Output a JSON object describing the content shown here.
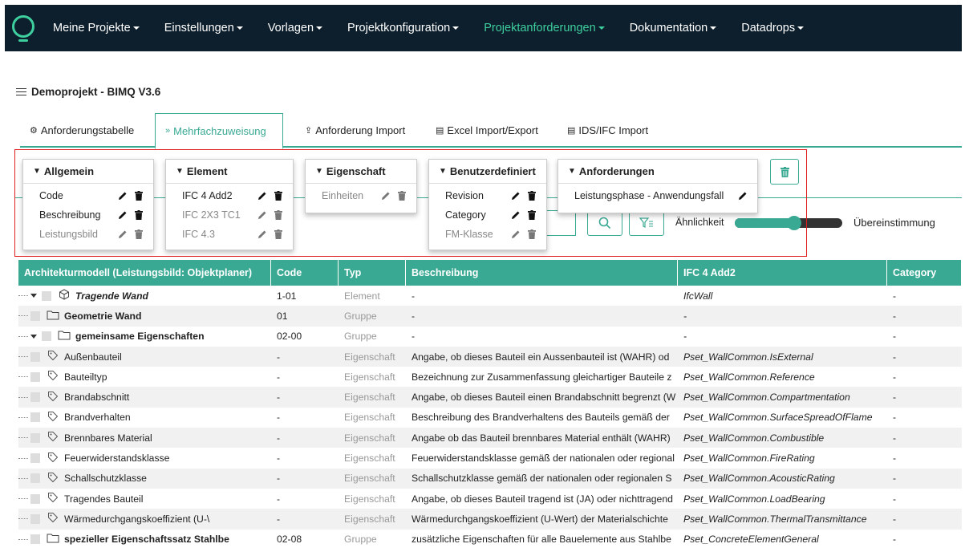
{
  "nav": {
    "items": [
      {
        "label": "Meine Projekte",
        "caret": true
      },
      {
        "label": "Einstellungen",
        "caret": true
      },
      {
        "label": "Vorlagen",
        "caret": true
      },
      {
        "label": "Projektkonfiguration",
        "caret": true
      },
      {
        "label": "Projektanforderungen",
        "caret": true,
        "active": true
      },
      {
        "label": "Dokumentation",
        "caret": true
      },
      {
        "label": "Datadrops",
        "caret": true
      }
    ],
    "accent": "#3ecf9e",
    "background": "#0d1f2d"
  },
  "project_title": "Demoprojekt - BIMQ V3.6",
  "tabs": [
    {
      "label": "Anforderungstabelle",
      "icon": "cogs-icon"
    },
    {
      "label": "Mehrfachzuweisung",
      "icon": "double-chevron-right-icon",
      "active": true
    },
    {
      "label": "Anforderung Import",
      "icon": "upload-icon"
    },
    {
      "label": "Excel Import/Export",
      "icon": "file-excel-icon"
    },
    {
      "label": "IDS/IFC Import",
      "icon": "file-import-icon"
    }
  ],
  "panels": [
    {
      "title": "Allgemein",
      "rows": [
        {
          "label": "Code",
          "dim": false
        },
        {
          "label": "Beschreibung",
          "dim": false
        },
        {
          "label": "Leistungsbild",
          "dim": true
        }
      ]
    },
    {
      "title": "Element",
      "rows": [
        {
          "label": "IFC 4 Add2",
          "dim": false
        },
        {
          "label": "IFC 2X3 TC1",
          "dim": true
        },
        {
          "label": "IFC 4.3",
          "dim": true
        }
      ]
    },
    {
      "title": "Eigenschaft",
      "rows": [
        {
          "label": "Einheiten",
          "dim": true
        }
      ]
    },
    {
      "title": "Benutzerdefiniert",
      "rows": [
        {
          "label": "Revision",
          "dim": false
        },
        {
          "label": "Category",
          "dim": false
        },
        {
          "label": "FM-Klasse",
          "dim": true
        }
      ]
    },
    {
      "title": "Anforderungen",
      "rows": [
        {
          "label": "Leistungsphase - Anwendungsfall",
          "dim": false,
          "no_trash": true
        }
      ]
    }
  ],
  "similarity": {
    "label": "Ähnlichkeit",
    "match_label": "Übereinstimmung",
    "value": 0.55
  },
  "table": {
    "columns": [
      "Architekturmodell (Leistungsbild: Objektplaner)",
      "Code",
      "Typ",
      "Beschreibung",
      "IFC 4 Add2",
      "Category"
    ],
    "rows": [
      {
        "indent": 0,
        "icon": "cube-icon",
        "name": "Tragende Wand",
        "style": "bi",
        "code": "1-01",
        "typ": "Element",
        "desc": "-",
        "ifc": "IfcWall",
        "cat": "-",
        "expanded": true
      },
      {
        "indent": 1,
        "icon": "folder-icon",
        "name": "Geometrie Wand",
        "style": "bold",
        "code": "01",
        "typ": "Gruppe",
        "desc": "-",
        "ifc": "-",
        "cat": "-"
      },
      {
        "indent": 1,
        "icon": "folder-icon",
        "name": "gemeinsame Eigenschaften",
        "style": "bold",
        "code": "02-00",
        "typ": "Gruppe",
        "desc": "-",
        "ifc": "-",
        "cat": "-",
        "expanded": true
      },
      {
        "indent": 2,
        "icon": "tag-icon",
        "name": "Außenbauteil",
        "style": "",
        "code": "-",
        "typ": "Eigenschaft",
        "desc": "Angabe, ob dieses Bauteil ein Aussenbauteil ist (WAHR) od",
        "ifc": "Pset_WallCommon.IsExternal",
        "cat": "-"
      },
      {
        "indent": 2,
        "icon": "tag-icon",
        "name": "Bauteiltyp",
        "style": "",
        "code": "-",
        "typ": "Eigenschaft",
        "desc": "Bezeichnung zur Zusammenfassung gleichartiger Bauteile z",
        "ifc": "Pset_WallCommon.Reference",
        "cat": "-"
      },
      {
        "indent": 2,
        "icon": "tag-icon",
        "name": "Brandabschnitt",
        "style": "",
        "code": "-",
        "typ": "Eigenschaft",
        "desc": "Angabe, ob dieses Bauteil einen Brandabschnitt begrenzt (W",
        "ifc": "Pset_WallCommon.Compartmentation",
        "cat": "-"
      },
      {
        "indent": 2,
        "icon": "tag-icon",
        "name": "Brandverhalten",
        "style": "",
        "code": "-",
        "typ": "Eigenschaft",
        "desc": "Beschreibung des Brandverhaltens des Bauteils gemäß der",
        "ifc": "Pset_WallCommon.SurfaceSpreadOfFlame",
        "cat": "-"
      },
      {
        "indent": 2,
        "icon": "tag-icon",
        "name": "Brennbares Material",
        "style": "",
        "code": "-",
        "typ": "Eigenschaft",
        "desc": "Angabe ob das Bauteil brennbares Material enthält (WAHR)",
        "ifc": "Pset_WallCommon.Combustible",
        "cat": "-"
      },
      {
        "indent": 2,
        "icon": "tag-icon",
        "name": "Feuerwiderstandsklasse",
        "style": "",
        "code": "-",
        "typ": "Eigenschaft",
        "desc": "Feuerwiderstandsklasse gemäß der nationalen oder regional",
        "ifc": "Pset_WallCommon.FireRating",
        "cat": "-"
      },
      {
        "indent": 2,
        "icon": "tag-icon",
        "name": "Schallschutzklasse",
        "style": "",
        "code": "-",
        "typ": "Eigenschaft",
        "desc": "Schallschutzklasse gemäß der nationalen oder regionalen S",
        "ifc": "Pset_WallCommon.AcousticRating",
        "cat": "-"
      },
      {
        "indent": 2,
        "icon": "tag-icon",
        "name": "Tragendes Bauteil",
        "style": "",
        "code": "-",
        "typ": "Eigenschaft",
        "desc": "Angabe, ob dieses Bauteil tragend ist (JA) oder nichttragend",
        "ifc": "Pset_WallCommon.LoadBearing",
        "cat": "-"
      },
      {
        "indent": 2,
        "icon": "tag-icon",
        "name": "Wärmedurchgangskoeffizient (U-\\",
        "style": "",
        "code": "-",
        "typ": "Eigenschaft",
        "desc": "Wärmedurchgangskoeffizient (U-Wert) der Materialschichte",
        "ifc": "Pset_WallCommon.ThermalTransmittance",
        "cat": "-"
      },
      {
        "indent": 1,
        "icon": "folder-icon",
        "name": "spezieller Eigenschaftssatz Stahlbe",
        "style": "bold",
        "code": "02-08",
        "typ": "Gruppe",
        "desc": "zusätzliche Eigenschaften für alle Bauelemente aus Stahlbe",
        "ifc": "Pset_ConcreteElementGeneral",
        "cat": "-"
      }
    ]
  },
  "colors": {
    "accent": "#3aa993",
    "highlight_outline": "#e01e1e"
  }
}
